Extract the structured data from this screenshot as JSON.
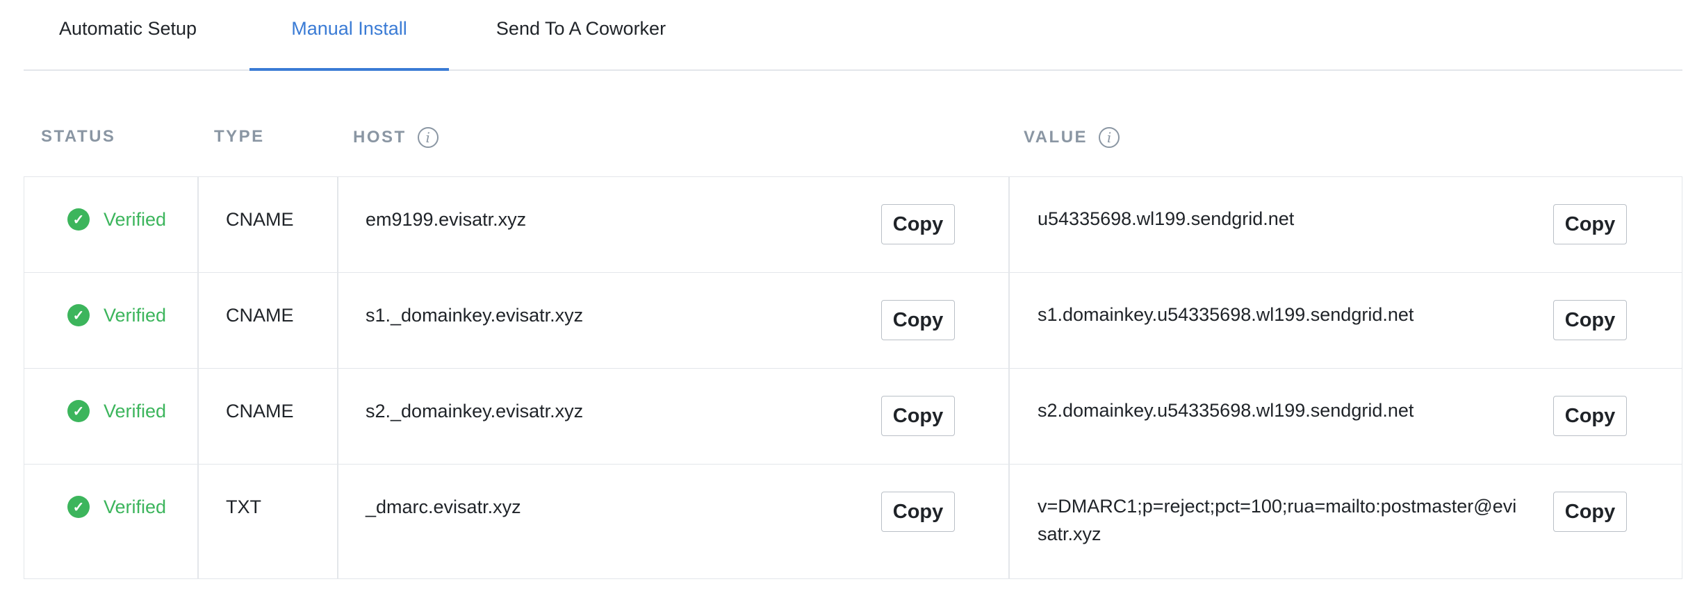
{
  "tabs": [
    {
      "label": "Automatic Setup"
    },
    {
      "label": "Manual Install"
    },
    {
      "label": "Send To A Coworker"
    }
  ],
  "table": {
    "headers": {
      "status": "STATUS",
      "type": "TYPE",
      "host": "HOST",
      "value": "VALUE"
    },
    "info_icon_glyph": "i",
    "copy_label": "Copy",
    "check_glyph": "✓",
    "rows": [
      {
        "status": "Verified",
        "type": "CNAME",
        "host": "em9199.evisatr.xyz",
        "value": "u54335698.wl199.sendgrid.net"
      },
      {
        "status": "Verified",
        "type": "CNAME",
        "host": "s1._domainkey.evisatr.xyz",
        "value": "s1.domainkey.u54335698.wl199.sendgrid.net"
      },
      {
        "status": "Verified",
        "type": "CNAME",
        "host": "s2._domainkey.evisatr.xyz",
        "value": "s2.domainkey.u54335698.wl199.sendgrid.net"
      },
      {
        "status": "Verified",
        "type": "TXT",
        "host": "_dmarc.evisatr.xyz",
        "value": "v=DMARC1;p=reject;pct=100;rua=mailto:postmaster@evisatr.xyz"
      }
    ]
  },
  "colors": {
    "accent": "#3a7bd5",
    "verified": "#3cb55c",
    "header_text": "#8a96a3",
    "border": "#e3e6ea"
  },
  "icons": {
    "info": "info-circle-icon",
    "verified": "check-circle-icon"
  }
}
